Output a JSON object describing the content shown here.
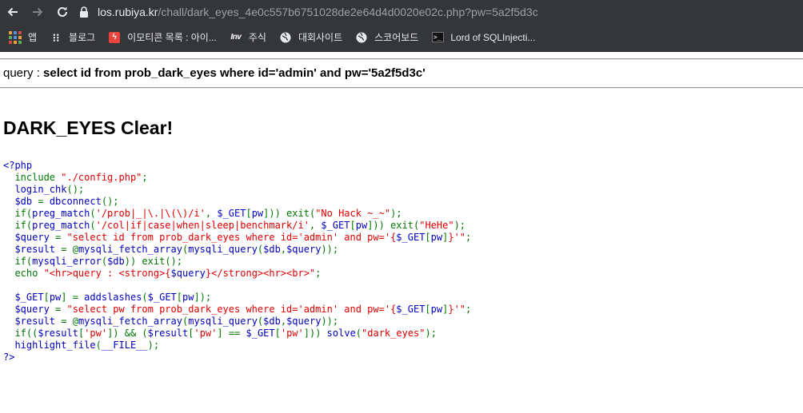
{
  "browser": {
    "url_host": "los.rubiya.kr",
    "url_path": "/chall/dark_eyes_4e0c557b6751028de2e64d4d0020e02c.php?pw=5a2f5d3c",
    "bookmarks": [
      {
        "label": "앱",
        "icon": "apps-grid-icon"
      },
      {
        "label": "블로그",
        "icon": "blog-icon"
      },
      {
        "label": "이모티콘 목록 : 아이...",
        "icon": "emoticon-icon"
      },
      {
        "label": "주식",
        "icon": "investing-icon"
      },
      {
        "label": "대회사이트",
        "icon": "globe-icon"
      },
      {
        "label": "스코어보드",
        "icon": "globe-icon"
      },
      {
        "label": "Lord of SQLInjecti...",
        "icon": "terminal-icon"
      }
    ]
  },
  "page": {
    "query_label": "query : ",
    "query_value": "select id from prob_dark_eyes where id='admin' and pw='5a2f5d3c'",
    "clear_title": "DARK_EYES Clear!"
  },
  "code": {
    "lines": [
      [
        {
          "t": "<?php",
          "c": "php"
        }
      ],
      [
        {
          "t": "  include ",
          "c": "kw"
        },
        {
          "t": "\"./config.php\"",
          "c": "str"
        },
        {
          "t": ";",
          "c": "kw"
        }
      ],
      [
        {
          "t": "  login_chk",
          "c": "def"
        },
        {
          "t": "();",
          "c": "kw"
        }
      ],
      [
        {
          "t": "  $db ",
          "c": "def"
        },
        {
          "t": "= ",
          "c": "kw"
        },
        {
          "t": "dbconnect",
          "c": "def"
        },
        {
          "t": "();",
          "c": "kw"
        }
      ],
      [
        {
          "t": "  if(",
          "c": "kw"
        },
        {
          "t": "preg_match",
          "c": "def"
        },
        {
          "t": "(",
          "c": "kw"
        },
        {
          "t": "'/prob|_|\\.|\\(\\)/i'",
          "c": "str"
        },
        {
          "t": ", ",
          "c": "kw"
        },
        {
          "t": "$_GET",
          "c": "def"
        },
        {
          "t": "[",
          "c": "kw"
        },
        {
          "t": "pw",
          "c": "def"
        },
        {
          "t": "])) exit(",
          "c": "kw"
        },
        {
          "t": "\"No Hack ~_~\"",
          "c": "str"
        },
        {
          "t": ");",
          "c": "kw"
        }
      ],
      [
        {
          "t": "  if(",
          "c": "kw"
        },
        {
          "t": "preg_match",
          "c": "def"
        },
        {
          "t": "(",
          "c": "kw"
        },
        {
          "t": "'/col|if|case|when|sleep|benchmark/i'",
          "c": "str"
        },
        {
          "t": ", ",
          "c": "kw"
        },
        {
          "t": "$_GET",
          "c": "def"
        },
        {
          "t": "[",
          "c": "kw"
        },
        {
          "t": "pw",
          "c": "def"
        },
        {
          "t": "])) exit(",
          "c": "kw"
        },
        {
          "t": "\"HeHe\"",
          "c": "str"
        },
        {
          "t": ");",
          "c": "kw"
        }
      ],
      [
        {
          "t": "  $query ",
          "c": "def"
        },
        {
          "t": "= ",
          "c": "kw"
        },
        {
          "t": "\"select id from prob_dark_eyes where id='admin' and pw='{",
          "c": "str"
        },
        {
          "t": "$_GET",
          "c": "def"
        },
        {
          "t": "[",
          "c": "kw"
        },
        {
          "t": "pw",
          "c": "def"
        },
        {
          "t": "]",
          "c": "kw"
        },
        {
          "t": "}'\"",
          "c": "str"
        },
        {
          "t": ";",
          "c": "kw"
        }
      ],
      [
        {
          "t": "  $result ",
          "c": "def"
        },
        {
          "t": "= @",
          "c": "kw"
        },
        {
          "t": "mysqli_fetch_array",
          "c": "def"
        },
        {
          "t": "(",
          "c": "kw"
        },
        {
          "t": "mysqli_query",
          "c": "def"
        },
        {
          "t": "(",
          "c": "kw"
        },
        {
          "t": "$db",
          "c": "def"
        },
        {
          "t": ",",
          "c": "kw"
        },
        {
          "t": "$query",
          "c": "def"
        },
        {
          "t": "));",
          "c": "kw"
        }
      ],
      [
        {
          "t": "  if(",
          "c": "kw"
        },
        {
          "t": "mysqli_error",
          "c": "def"
        },
        {
          "t": "(",
          "c": "kw"
        },
        {
          "t": "$db",
          "c": "def"
        },
        {
          "t": ")) exit();",
          "c": "kw"
        }
      ],
      [
        {
          "t": "  echo ",
          "c": "kw"
        },
        {
          "t": "\"<hr>query : <strong>{",
          "c": "str"
        },
        {
          "t": "$query",
          "c": "def"
        },
        {
          "t": "}</strong><hr><br>\"",
          "c": "str"
        },
        {
          "t": ";",
          "c": "kw"
        }
      ],
      [
        {
          "t": "",
          "c": "kw"
        }
      ],
      [
        {
          "t": "  $_GET",
          "c": "def"
        },
        {
          "t": "[",
          "c": "kw"
        },
        {
          "t": "pw",
          "c": "def"
        },
        {
          "t": "] = ",
          "c": "kw"
        },
        {
          "t": "addslashes",
          "c": "def"
        },
        {
          "t": "(",
          "c": "kw"
        },
        {
          "t": "$_GET",
          "c": "def"
        },
        {
          "t": "[",
          "c": "kw"
        },
        {
          "t": "pw",
          "c": "def"
        },
        {
          "t": "]);",
          "c": "kw"
        }
      ],
      [
        {
          "t": "  $query ",
          "c": "def"
        },
        {
          "t": "= ",
          "c": "kw"
        },
        {
          "t": "\"select pw from prob_dark_eyes where id='admin' and pw='{",
          "c": "str"
        },
        {
          "t": "$_GET",
          "c": "def"
        },
        {
          "t": "[",
          "c": "kw"
        },
        {
          "t": "pw",
          "c": "def"
        },
        {
          "t": "]",
          "c": "kw"
        },
        {
          "t": "}'\"",
          "c": "str"
        },
        {
          "t": ";",
          "c": "kw"
        }
      ],
      [
        {
          "t": "  $result ",
          "c": "def"
        },
        {
          "t": "= @",
          "c": "kw"
        },
        {
          "t": "mysqli_fetch_array",
          "c": "def"
        },
        {
          "t": "(",
          "c": "kw"
        },
        {
          "t": "mysqli_query",
          "c": "def"
        },
        {
          "t": "(",
          "c": "kw"
        },
        {
          "t": "$db",
          "c": "def"
        },
        {
          "t": ",",
          "c": "kw"
        },
        {
          "t": "$query",
          "c": "def"
        },
        {
          "t": "));",
          "c": "kw"
        }
      ],
      [
        {
          "t": "  if((",
          "c": "kw"
        },
        {
          "t": "$result",
          "c": "def"
        },
        {
          "t": "[",
          "c": "kw"
        },
        {
          "t": "'pw'",
          "c": "str"
        },
        {
          "t": "]) && (",
          "c": "kw"
        },
        {
          "t": "$result",
          "c": "def"
        },
        {
          "t": "[",
          "c": "kw"
        },
        {
          "t": "'pw'",
          "c": "str"
        },
        {
          "t": "] == ",
          "c": "kw"
        },
        {
          "t": "$_GET",
          "c": "def"
        },
        {
          "t": "[",
          "c": "kw"
        },
        {
          "t": "'pw'",
          "c": "str"
        },
        {
          "t": "])) ",
          "c": "kw"
        },
        {
          "t": "solve",
          "c": "def"
        },
        {
          "t": "(",
          "c": "kw"
        },
        {
          "t": "\"dark_eyes\"",
          "c": "str"
        },
        {
          "t": ");",
          "c": "kw"
        }
      ],
      [
        {
          "t": "  highlight_file",
          "c": "def"
        },
        {
          "t": "(",
          "c": "kw"
        },
        {
          "t": "__FILE__",
          "c": "def"
        },
        {
          "t": ");",
          "c": "kw"
        }
      ],
      [
        {
          "t": "?>",
          "c": "php"
        }
      ]
    ]
  },
  "colors": {
    "chrome_bg": "#35363a",
    "code_keyword": "#007700",
    "code_string": "#dd0000",
    "code_default": "#0000bb"
  }
}
